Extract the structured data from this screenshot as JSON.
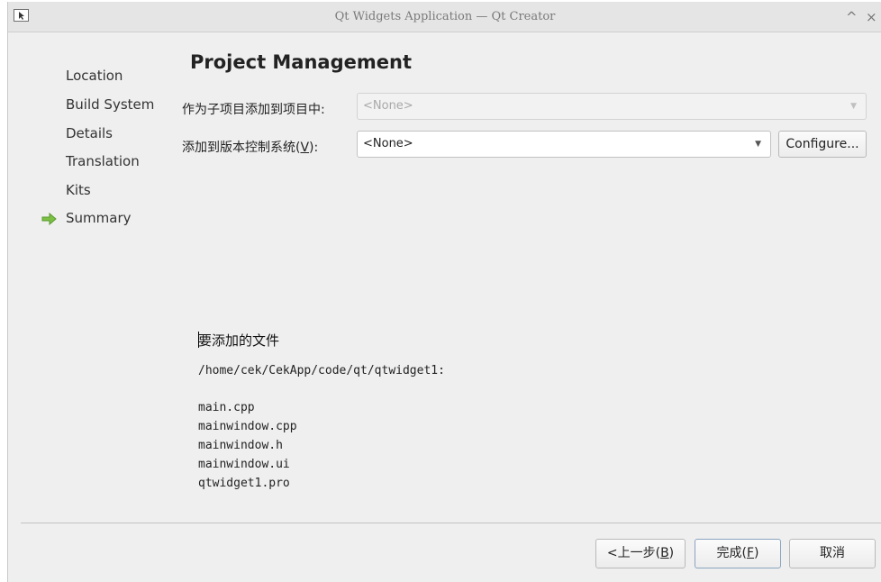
{
  "window": {
    "title": "Qt Widgets Application — Qt Creator",
    "controls": {
      "minimize_symbol": "^",
      "close_symbol": "×"
    }
  },
  "sidebar": {
    "steps": [
      {
        "label": "Location"
      },
      {
        "label": "Build System"
      },
      {
        "label": "Details"
      },
      {
        "label": "Translation"
      },
      {
        "label": "Kits"
      },
      {
        "label": "Summary",
        "current": true
      }
    ],
    "current_marker_icon": "green-arrow-right-icon"
  },
  "page": {
    "heading": "Project Management",
    "add_as_subproject": {
      "label": "作为子项目添加到项目中:",
      "value": "<None>",
      "enabled": false
    },
    "add_to_vcs": {
      "label_prefix": "添加到版本控制系统(",
      "label_mnemonic": "V",
      "label_suffix": "):",
      "value": "<None>",
      "enabled": true
    },
    "configure_button": "Configure...",
    "files_title": "要添加的文件",
    "files_directory": "/home/cek/CekApp/code/qt/qtwidget1:",
    "files": [
      "main.cpp",
      "mainwindow.cpp",
      "mainwindow.h",
      "mainwindow.ui",
      "qtwidget1.pro"
    ]
  },
  "footer": {
    "back_button": {
      "prefix": "<上一步(",
      "mnemonic": "B",
      "suffix": ")"
    },
    "finish_button": {
      "prefix": "完成(",
      "mnemonic": "F",
      "suffix": ")"
    },
    "cancel_button": "取消"
  },
  "colors": {
    "accent_arrow": "#7cc043",
    "window_bg": "#efefef",
    "titlebar_bg": "#e5e5e5"
  }
}
